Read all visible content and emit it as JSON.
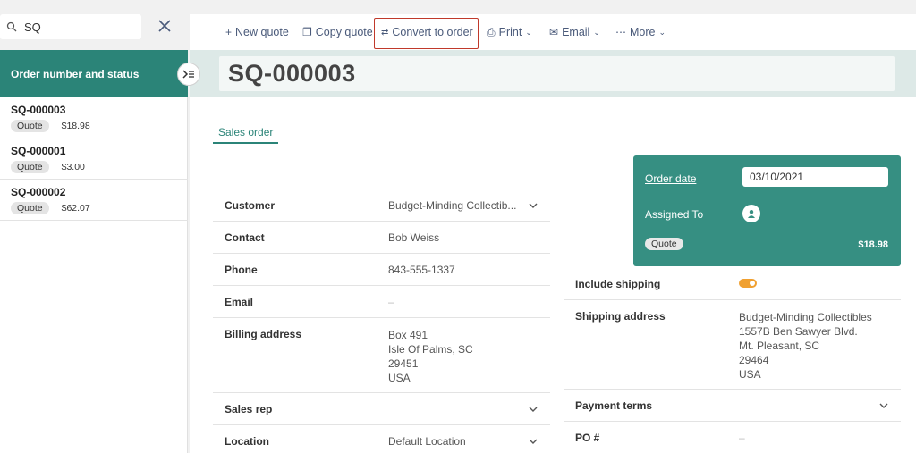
{
  "search": {
    "value": "SQ"
  },
  "list": {
    "header": "Order number and status",
    "items": [
      {
        "number": "SQ-000003",
        "status": "Quote",
        "amount": "$18.98"
      },
      {
        "number": "SQ-000001",
        "status": "Quote",
        "amount": "$3.00"
      },
      {
        "number": "SQ-000002",
        "status": "Quote",
        "amount": "$62.07"
      }
    ]
  },
  "toolbar": {
    "new_quote": "New quote",
    "copy_quote": "Copy quote",
    "convert_to_order": "Convert to order",
    "print": "Print",
    "email": "Email",
    "more": "More"
  },
  "title": "SQ-000003",
  "tab": "Sales order",
  "fields": {
    "customer": {
      "label": "Customer",
      "value": "Budget-Minding Collectib..."
    },
    "contact": {
      "label": "Contact",
      "value": "Bob Weiss"
    },
    "phone": {
      "label": "Phone",
      "value": "843-555-1337"
    },
    "email": {
      "label": "Email",
      "value": "–"
    },
    "billing": {
      "label": "Billing address",
      "lines": [
        "Box 491",
        "Isle Of Palms, SC",
        "29451",
        "USA"
      ]
    },
    "sales_rep": {
      "label": "Sales rep"
    },
    "location": {
      "label": "Location",
      "value": "Default Location"
    }
  },
  "card": {
    "order_date_label": "Order date",
    "order_date": "03/10/2021",
    "assigned_to_label": "Assigned To",
    "status": "Quote",
    "total": "$18.98"
  },
  "right": {
    "include_shipping": "Include shipping",
    "shipping_label": "Shipping address",
    "shipping_lines": [
      "Budget-Minding Collectibles",
      "1557B Ben Sawyer Blvd.",
      "Mt. Pleasant, SC",
      "29464",
      "USA"
    ],
    "payment_terms": "Payment terms",
    "po_label": "PO #",
    "po_value": "–"
  },
  "colors": {
    "accent": "#2b8478",
    "card": "#368f82",
    "highlight": "#c0392b",
    "toggle": "#f0a030"
  }
}
